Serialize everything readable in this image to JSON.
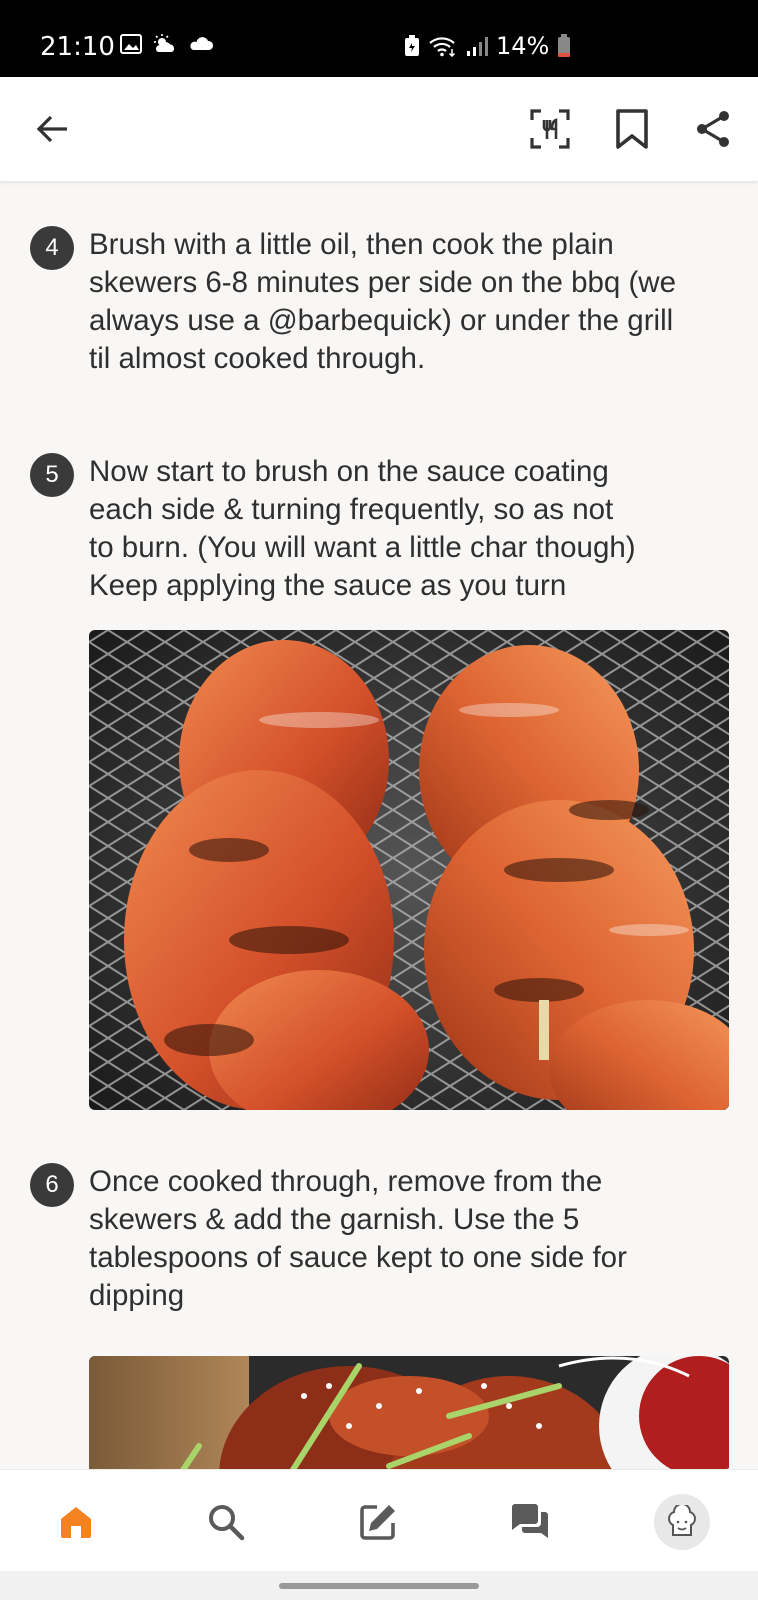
{
  "status_bar": {
    "time": "21:10",
    "left_icons": [
      "image-icon",
      "weather-sun-cloud-icon",
      "cloud-icon"
    ],
    "right_icons": [
      "battery-saver-icon",
      "wifi-icon",
      "signal-icon"
    ],
    "battery": "14%",
    "battery_color": "#e0533b"
  },
  "top_bar": {
    "icons": [
      "back-arrow-icon",
      "cook-mode-icon",
      "bookmark-icon",
      "share-icon"
    ]
  },
  "steps": [
    {
      "number": "4",
      "text": "Brush with a little oil, then cook the plain\nskewers 6-8 minutes per side on the bbq (we\nalways use a @barbequick) or under the grill\ntil almost cooked through."
    },
    {
      "number": "5",
      "text": "Now start to brush on the sauce coating\neach side & turning frequently, so as not\nto burn. (You will want a little char though)\nKeep applying the sauce as you turn",
      "photo": "grilled-chicken-skewers-photo"
    },
    {
      "number": "6",
      "text": "Once cooked through, remove from the\nskewers & add the garnish. Use the 5\ntablespoons of sauce kept to one side for\ndipping",
      "photo": "chicken-with-garnish-photo"
    }
  ],
  "bottom_nav": {
    "items": [
      "home-icon",
      "search-icon",
      "write-recipe-icon",
      "chat-icon",
      "profile-chef-icon"
    ],
    "active": "home-icon",
    "accent_color": "#f58220"
  }
}
